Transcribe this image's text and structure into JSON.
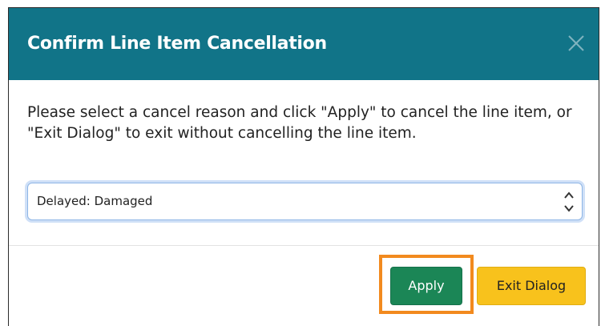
{
  "dialog": {
    "title": "Confirm Line Item Cancellation",
    "close_icon": "close-icon",
    "message": "Please select a cancel reason and click \"Apply\" to cancel the line item, or \"Exit Dialog\" to exit without cancelling the line item.",
    "select": {
      "selected_value": "Delayed: Damaged",
      "arrows_icon": "chevron-up-down-icon"
    },
    "buttons": {
      "apply_label": "Apply",
      "exit_label": "Exit Dialog"
    }
  },
  "colors": {
    "header_bg": "#117488",
    "apply_bg": "#1b8656",
    "exit_bg": "#f8c21c",
    "highlight": "#f28a1e",
    "focus_ring": "#cfe0f7"
  }
}
